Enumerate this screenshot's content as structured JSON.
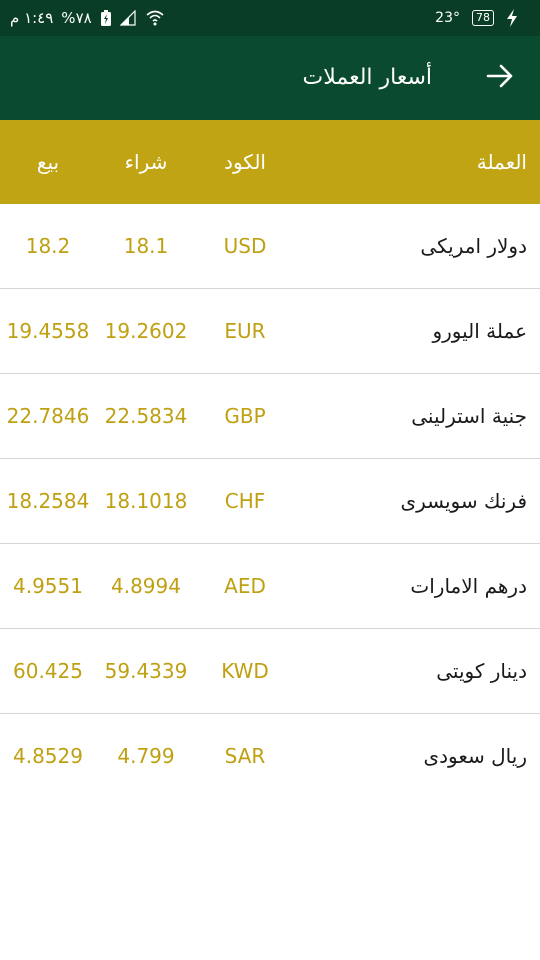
{
  "status_bar": {
    "time": "١:٤٩ م",
    "battery_percent": "%٧٨",
    "temperature": "23°",
    "badge": "78"
  },
  "app_bar": {
    "title": "أسعار العملات"
  },
  "table": {
    "headers": {
      "currency": "العملة",
      "code": "الكود",
      "buy": "شراء",
      "sell": "بيع"
    },
    "rows": [
      {
        "name": "دولار امريكى",
        "code": "USD",
        "buy": "18.1",
        "sell": "18.2"
      },
      {
        "name": "عملة اليورو",
        "code": "EUR",
        "buy": "19.2602",
        "sell": "19.4558"
      },
      {
        "name": "جنية استرلينى",
        "code": "GBP",
        "buy": "22.5834",
        "sell": "22.7846"
      },
      {
        "name": "فرنك سويسرى",
        "code": "CHF",
        "buy": "18.1018",
        "sell": "18.2584"
      },
      {
        "name": "درهم الامارات",
        "code": "AED",
        "buy": "4.8994",
        "sell": "4.9551"
      },
      {
        "name": "دينار كويتى",
        "code": "KWD",
        "buy": "59.4339",
        "sell": "60.425"
      },
      {
        "name": "ريال سعودى",
        "code": "SAR",
        "buy": "4.799",
        "sell": "4.8529"
      }
    ]
  },
  "colors": {
    "status_bar": "#0a3d26",
    "app_bar": "#0a4a2e",
    "header_bg": "#c0a414",
    "value_text": "#bfa012"
  },
  "icons": {
    "back": "arrow-right-icon",
    "wifi": "wifi-icon",
    "signal": "signal-icon",
    "battery": "battery-icon",
    "charge": "lightning-icon"
  }
}
